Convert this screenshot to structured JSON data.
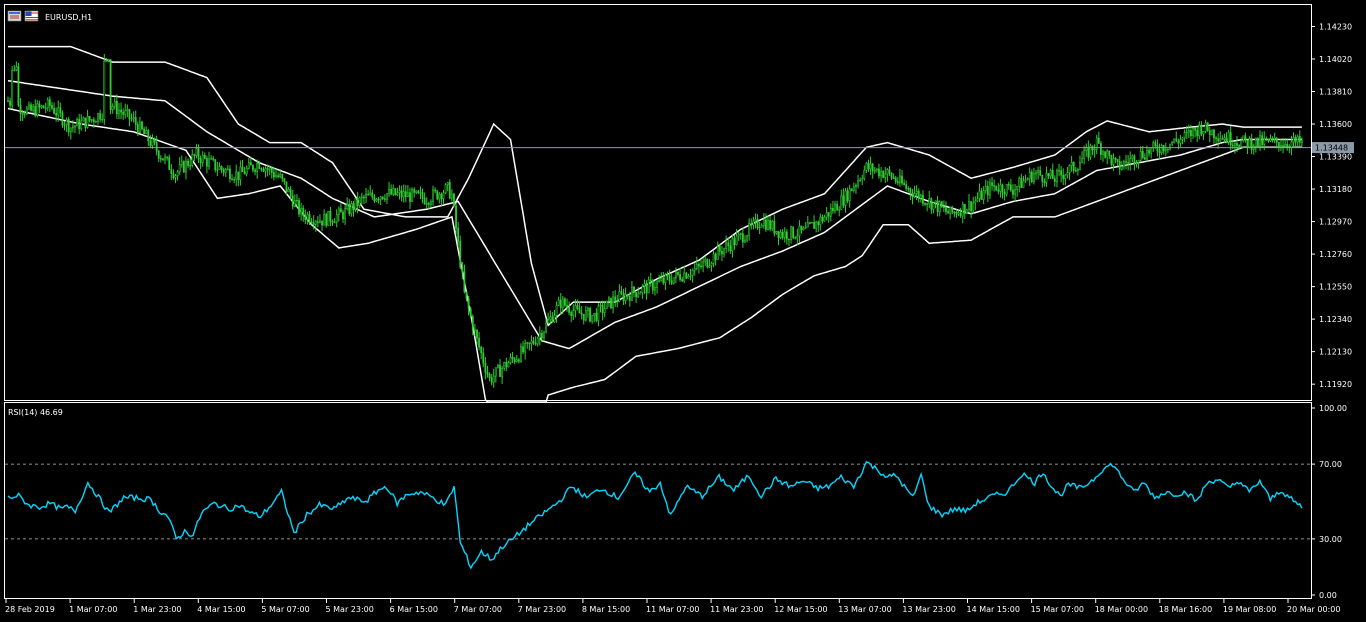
{
  "symbol_label": "EURUSD,H1",
  "current_price_label": "1.13448",
  "colors": {
    "background": "#000000",
    "frame": "#ffffff",
    "candle": "#32cd32",
    "bands": "#ffffff",
    "price_line": "#8c9aa8",
    "price_tag_bg": "#8c9aa8",
    "rsi": "#00d8ff",
    "levels": "#c0c0c0"
  },
  "chart_data": [
    {
      "type": "candlestick",
      "title": "EURUSD,H1",
      "indicator": "Bollinger Bands",
      "ylim": [
        1.1185,
        1.1433
      ],
      "yticks": [
        "1.14230",
        "1.14020",
        "1.13810",
        "1.13600",
        "1.13390",
        "1.13180",
        "1.12970",
        "1.12760",
        "1.12550",
        "1.12340",
        "1.12130",
        "1.11920"
      ],
      "current_price": 1.13448,
      "close_anchors": [
        [
          0,
          1.1375
        ],
        [
          10,
          1.1368
        ],
        [
          20,
          1.1372
        ],
        [
          30,
          1.1358
        ],
        [
          40,
          1.1363
        ],
        [
          50,
          1.1372
        ],
        [
          60,
          1.1362
        ],
        [
          70,
          1.1345
        ],
        [
          80,
          1.1328
        ],
        [
          90,
          1.134
        ],
        [
          100,
          1.1332
        ],
        [
          110,
          1.1327
        ],
        [
          120,
          1.1335
        ],
        [
          130,
          1.1325
        ],
        [
          140,
          1.1302
        ],
        [
          150,
          1.1298
        ],
        [
          160,
          1.1302
        ],
        [
          170,
          1.1312
        ],
        [
          180,
          1.1315
        ],
        [
          190,
          1.1314
        ],
        [
          200,
          1.1312
        ],
        [
          210,
          1.1318
        ],
        [
          212,
          1.1314
        ],
        [
          218,
          1.125
        ],
        [
          224,
          1.122
        ],
        [
          230,
          1.1195
        ],
        [
          238,
          1.1205
        ],
        [
          248,
          1.1215
        ],
        [
          256,
          1.1228
        ],
        [
          264,
          1.1245
        ],
        [
          272,
          1.1238
        ],
        [
          280,
          1.1236
        ],
        [
          290,
          1.1247
        ],
        [
          300,
          1.1252
        ],
        [
          310,
          1.1257
        ],
        [
          320,
          1.1262
        ],
        [
          330,
          1.1267
        ],
        [
          340,
          1.1278
        ],
        [
          350,
          1.1287
        ],
        [
          360,
          1.1298
        ],
        [
          370,
          1.1289
        ],
        [
          380,
          1.129
        ],
        [
          390,
          1.13
        ],
        [
          400,
          1.1313
        ],
        [
          410,
          1.1332
        ],
        [
          420,
          1.1328
        ],
        [
          430,
          1.1318
        ],
        [
          440,
          1.131
        ],
        [
          450,
          1.1302
        ],
        [
          460,
          1.1308
        ],
        [
          470,
          1.132
        ],
        [
          480,
          1.1318
        ],
        [
          490,
          1.1328
        ],
        [
          500,
          1.1325
        ],
        [
          510,
          1.1333
        ],
        [
          520,
          1.1348
        ],
        [
          530,
          1.1332
        ],
        [
          540,
          1.134
        ],
        [
          550,
          1.1345
        ],
        [
          560,
          1.135
        ],
        [
          570,
          1.1358
        ],
        [
          580,
          1.1352
        ],
        [
          590,
          1.1348
        ]
      ],
      "spike_anchors": [
        [
          3,
          1.1398
        ],
        [
          47,
          1.1402
        ]
      ],
      "upper_band_anchors": [
        [
          0,
          1.141
        ],
        [
          30,
          1.141
        ],
        [
          50,
          1.14
        ],
        [
          75,
          1.14
        ],
        [
          95,
          1.139
        ],
        [
          110,
          1.136
        ],
        [
          125,
          1.1348
        ],
        [
          140,
          1.1348
        ],
        [
          155,
          1.1335
        ],
        [
          170,
          1.1305
        ],
        [
          190,
          1.13
        ],
        [
          210,
          1.13
        ],
        [
          220,
          1.1325
        ],
        [
          232,
          1.136
        ],
        [
          240,
          1.135
        ],
        [
          250,
          1.127
        ],
        [
          258,
          1.123
        ],
        [
          270,
          1.1245
        ],
        [
          290,
          1.1245
        ],
        [
          310,
          1.126
        ],
        [
          330,
          1.1272
        ],
        [
          350,
          1.1292
        ],
        [
          370,
          1.1305
        ],
        [
          390,
          1.1315
        ],
        [
          410,
          1.1345
        ],
        [
          420,
          1.1348
        ],
        [
          440,
          1.134
        ],
        [
          460,
          1.1325
        ],
        [
          480,
          1.1332
        ],
        [
          500,
          1.134
        ],
        [
          515,
          1.1355
        ],
        [
          525,
          1.1362
        ],
        [
          545,
          1.1355
        ],
        [
          565,
          1.1358
        ],
        [
          580,
          1.136
        ],
        [
          590,
          1.1358
        ]
      ],
      "middle_band_anchors": [
        [
          0,
          1.1388
        ],
        [
          30,
          1.1382
        ],
        [
          50,
          1.1378
        ],
        [
          75,
          1.1375
        ],
        [
          95,
          1.1355
        ],
        [
          120,
          1.1335
        ],
        [
          140,
          1.1325
        ],
        [
          155,
          1.1312
        ],
        [
          175,
          1.13
        ],
        [
          200,
          1.1305
        ],
        [
          215,
          1.131
        ],
        [
          235,
          1.1265
        ],
        [
          255,
          1.122
        ],
        [
          268,
          1.1215
        ],
        [
          290,
          1.1232
        ],
        [
          310,
          1.1242
        ],
        [
          330,
          1.1255
        ],
        [
          350,
          1.1268
        ],
        [
          370,
          1.1278
        ],
        [
          390,
          1.129
        ],
        [
          405,
          1.1305
        ],
        [
          420,
          1.132
        ],
        [
          440,
          1.131
        ],
        [
          460,
          1.1302
        ],
        [
          480,
          1.131
        ],
        [
          500,
          1.1315
        ],
        [
          520,
          1.133
        ],
        [
          540,
          1.1335
        ],
        [
          560,
          1.134
        ],
        [
          580,
          1.1348
        ],
        [
          590,
          1.135
        ]
      ],
      "lower_band_anchors": [
        [
          0,
          1.137
        ],
        [
          35,
          1.136
        ],
        [
          60,
          1.1355
        ],
        [
          85,
          1.1343
        ],
        [
          100,
          1.1312
        ],
        [
          115,
          1.1315
        ],
        [
          130,
          1.132
        ],
        [
          145,
          1.1295
        ],
        [
          158,
          1.128
        ],
        [
          172,
          1.1283
        ],
        [
          195,
          1.1292
        ],
        [
          212,
          1.13
        ],
        [
          222,
          1.123
        ],
        [
          232,
          1.115
        ],
        [
          252,
          1.115
        ],
        [
          258,
          1.1185
        ],
        [
          270,
          1.119
        ],
        [
          285,
          1.1195
        ],
        [
          300,
          1.121
        ],
        [
          320,
          1.1215
        ],
        [
          340,
          1.1222
        ],
        [
          355,
          1.1235
        ],
        [
          370,
          1.125
        ],
        [
          385,
          1.1262
        ],
        [
          400,
          1.1268
        ],
        [
          408,
          1.1275
        ],
        [
          418,
          1.1295
        ],
        [
          430,
          1.1295
        ],
        [
          440,
          1.1283
        ],
        [
          460,
          1.1285
        ],
        [
          480,
          1.13
        ],
        [
          500,
          1.13
        ],
        [
          520,
          1.131
        ],
        [
          540,
          1.132
        ],
        [
          560,
          1.133
        ],
        [
          580,
          1.134
        ],
        [
          590,
          1.1345
        ]
      ]
    },
    {
      "type": "line",
      "title": "RSI(14) 46.69",
      "series": [
        {
          "name": "RSI(14)",
          "anchor_values": [
            [
              0,
              52
            ],
            [
              5,
              53
            ],
            [
              10,
              48
            ],
            [
              15,
              47
            ],
            [
              20,
              49
            ],
            [
              25,
              46
            ],
            [
              28,
              47
            ],
            [
              32,
              45
            ],
            [
              38,
              60
            ],
            [
              42,
              54
            ],
            [
              48,
              44
            ],
            [
              55,
              52
            ],
            [
              60,
              52
            ],
            [
              68,
              51
            ],
            [
              72,
              45
            ],
            [
              76,
              42
            ],
            [
              80,
              30
            ],
            [
              84,
              34
            ],
            [
              88,
              32
            ],
            [
              92,
              44
            ],
            [
              98,
              49
            ],
            [
              105,
              46
            ],
            [
              110,
              48
            ],
            [
              115,
              44
            ],
            [
              120,
              42
            ],
            [
              125,
              48
            ],
            [
              130,
              55
            ],
            [
              136,
              33
            ],
            [
              142,
              43
            ],
            [
              148,
              48
            ],
            [
              155,
              46
            ],
            [
              162,
              52
            ],
            [
              170,
              50
            ],
            [
              176,
              56
            ],
            [
              180,
              58
            ],
            [
              185,
              49
            ],
            [
              190,
              54
            ],
            [
              196,
              55
            ],
            [
              202,
              52
            ],
            [
              208,
              48
            ],
            [
              212,
              58
            ],
            [
              215,
              28
            ],
            [
              220,
              15
            ],
            [
              225,
              23
            ],
            [
              230,
              19
            ],
            [
              235,
              26
            ],
            [
              240,
              30
            ],
            [
              248,
              38
            ],
            [
              255,
              44
            ],
            [
              262,
              50
            ],
            [
              268,
              58
            ],
            [
              275,
              52
            ],
            [
              282,
              57
            ],
            [
              290,
              52
            ],
            [
              298,
              65
            ],
            [
              305,
              55
            ],
            [
              310,
              60
            ],
            [
              315,
              42
            ],
            [
              322,
              58
            ],
            [
              330,
              53
            ],
            [
              338,
              63
            ],
            [
              345,
              56
            ],
            [
              352,
              64
            ],
            [
              358,
              53
            ],
            [
              365,
              62
            ],
            [
              372,
              58
            ],
            [
              378,
              61
            ],
            [
              385,
              57
            ],
            [
              390,
              58
            ],
            [
              396,
              63
            ],
            [
              402,
              58
            ],
            [
              408,
              71
            ],
            [
              412,
              68
            ],
            [
              418,
              63
            ],
            [
              422,
              64
            ],
            [
              426,
              58
            ],
            [
              430,
              52
            ],
            [
              434,
              64
            ],
            [
              438,
              47
            ],
            [
              444,
              43
            ],
            [
              450,
              46
            ],
            [
              456,
              45
            ],
            [
              460,
              49
            ],
            [
              468,
              53
            ],
            [
              475,
              55
            ],
            [
              482,
              65
            ],
            [
              488,
              60
            ],
            [
              492,
              66
            ],
            [
              496,
              58
            ],
            [
              500,
              53
            ],
            [
              504,
              59
            ],
            [
              510,
              57
            ],
            [
              516,
              62
            ],
            [
              520,
              67
            ],
            [
              525,
              70
            ],
            [
              530,
              62
            ],
            [
              535,
              55
            ],
            [
              540,
              60
            ],
            [
              545,
              52
            ],
            [
              550,
              55
            ],
            [
              555,
              54
            ],
            [
              560,
              55
            ],
            [
              565,
              50
            ],
            [
              570,
              60
            ],
            [
              575,
              62
            ],
            [
              580,
              57
            ],
            [
              585,
              61
            ],
            [
              590,
              55
            ],
            [
              595,
              61
            ],
            [
              600,
              51
            ],
            [
              605,
              56
            ],
            [
              610,
              51
            ],
            [
              615,
              47
            ]
          ],
          "last_value": 46.69
        }
      ],
      "ylim": [
        0,
        100
      ],
      "yticks": [
        "100.00",
        "70.00",
        "30.00",
        "0.00"
      ],
      "levels": [
        70,
        30
      ]
    }
  ],
  "x_axis": {
    "labels": [
      "28 Feb 2019",
      "1 Mar 07:00",
      "1 Mar 23:00",
      "4 Mar 15:00",
      "5 Mar 07:00",
      "5 Mar 23:00",
      "6 Mar 15:00",
      "7 Mar 07:00",
      "7 Mar 23:00",
      "8 Mar 15:00",
      "11 Mar 07:00",
      "11 Mar 23:00",
      "12 Mar 15:00",
      "13 Mar 07:00",
      "13 Mar 23:00",
      "14 Mar 15:00",
      "15 Mar 07:00",
      "18 Mar 00:00",
      "18 Mar 16:00",
      "19 Mar 08:00",
      "20 Mar 00:00"
    ]
  }
}
